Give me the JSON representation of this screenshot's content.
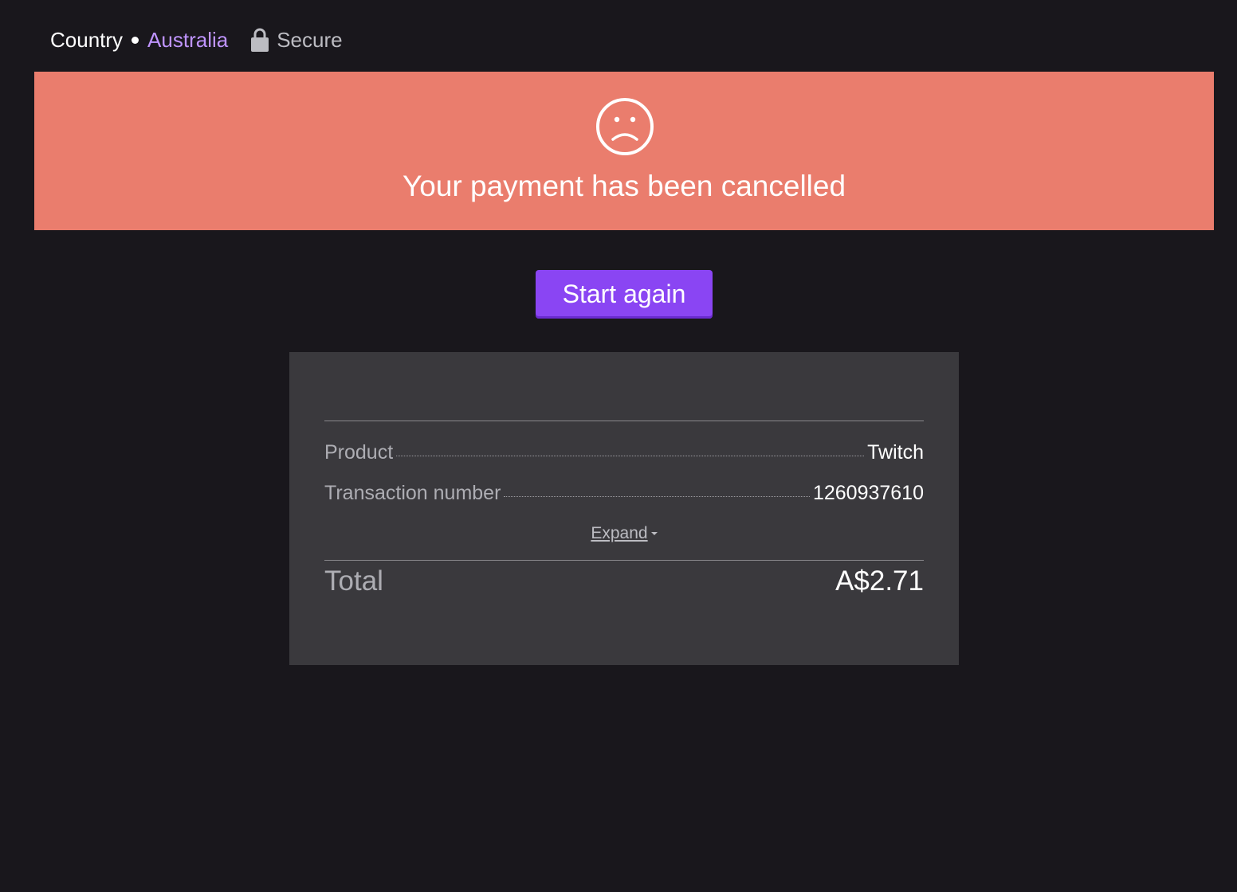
{
  "header": {
    "country_label": "Country",
    "country_value": "Australia",
    "secure_label": "Secure",
    "lock_icon": "lock-icon"
  },
  "banner": {
    "icon": "sad-face-icon",
    "message": "Your payment has been cancelled",
    "color": "#ea7d6d"
  },
  "actions": {
    "start_again_label": "Start again",
    "button_color": "#8a45f3"
  },
  "summary": {
    "items": [
      {
        "label": "Product",
        "value": "Twitch"
      },
      {
        "label": "Transaction number",
        "value": "1260937610"
      }
    ],
    "expand_label": "Expand",
    "expand_icon": "caret-down-icon",
    "total_label": "Total",
    "total_value": "A$2.71"
  },
  "colors": {
    "background": "#19171c",
    "accent": "#bf94ff",
    "panel": "#3a393d"
  }
}
